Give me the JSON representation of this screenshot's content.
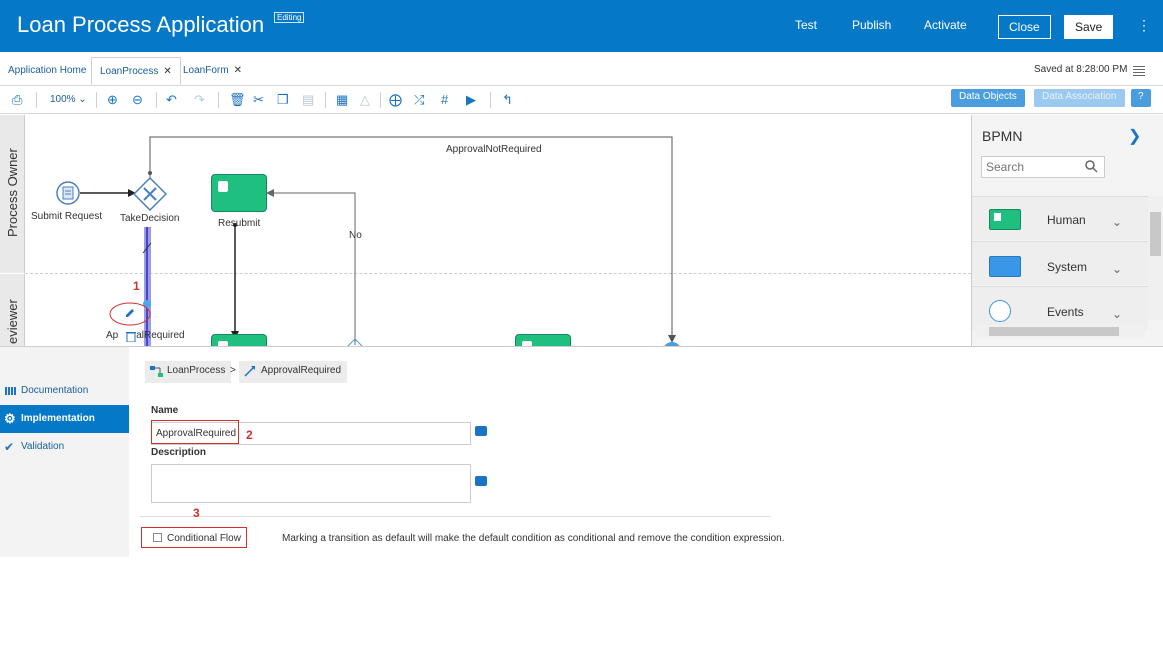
{
  "header": {
    "title": "Loan Process Application",
    "badge": "Editing",
    "test": "Test",
    "publish": "Publish",
    "activate": "Activate",
    "close": "Close",
    "save": "Save"
  },
  "tabs": {
    "items": [
      {
        "label": "Application Home"
      },
      {
        "label": "LoanProcess"
      },
      {
        "label": "LoanForm"
      }
    ],
    "saved": "Saved at 8:28:00 PM"
  },
  "toolbar": {
    "zoom": "100%",
    "data_objects": "Data Objects",
    "data_association": "Data Association",
    "help": "?"
  },
  "canvas": {
    "lanes": [
      "Process Owner",
      "eviewer"
    ],
    "flow_label_top": "ApprovalNotRequired",
    "flow_label_no": "No",
    "nodes": {
      "submit_request": "Submit Request",
      "take_decision": "TakeDecision",
      "resubmit": "Resubmit",
      "approval_required_frag": "Ap",
      "approval_required_frag2": "alRequired"
    },
    "annot1": "1"
  },
  "palette": {
    "title": "BPMN",
    "search_placeholder": "Search",
    "items": [
      {
        "label": "Human"
      },
      {
        "label": "System"
      },
      {
        "label": "Events"
      }
    ]
  },
  "sidebar": {
    "items": [
      {
        "label": "Documentation"
      },
      {
        "label": "Implementation"
      },
      {
        "label": "Validation"
      }
    ]
  },
  "breadcrumb": {
    "process": "LoanProcess",
    "sep": ">",
    "flow": "ApprovalRequired"
  },
  "form": {
    "name_label": "Name",
    "name_value": "ApprovalRequired",
    "description_label": "Description",
    "conditional_label": "Conditional Flow",
    "hint": "Marking a transition as default will make the default condition as conditional and remove the condition expression.",
    "annot2": "2",
    "annot3": "3"
  }
}
